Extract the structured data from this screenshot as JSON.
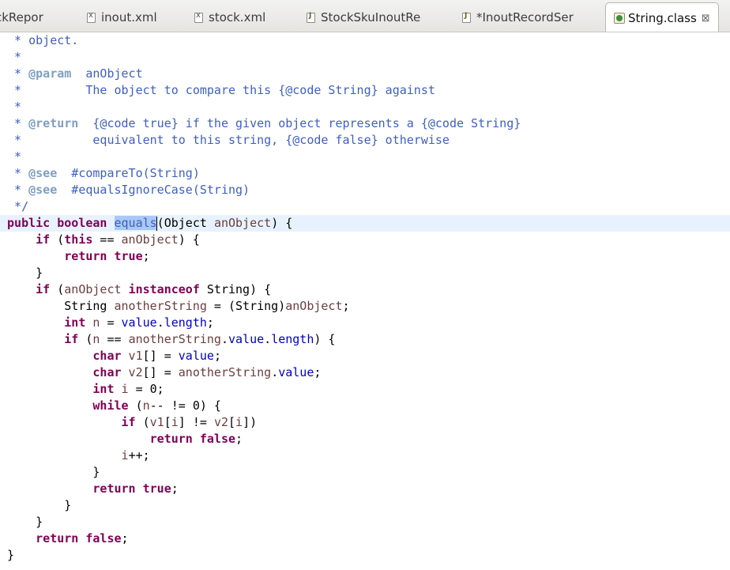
{
  "tabs": [
    {
      "label": "ckRepor",
      "icon": "none"
    },
    {
      "label": "inout.xml",
      "icon": "xml-file-icon"
    },
    {
      "label": "stock.xml",
      "icon": "xml-file-icon"
    },
    {
      "label": "StockSkuInoutRe",
      "icon": "java-file-icon"
    },
    {
      "label": "*InoutRecordSer",
      "icon": "java-file-icon"
    },
    {
      "label": "String.class",
      "icon": "class-file-icon",
      "active": true
    }
  ],
  "close_glyph": "⊠",
  "code": {
    "l1": "  * object.",
    "l2": "  *",
    "l3a": "  * ",
    "l3tag": "@param",
    "l3b": "  anObject",
    "l4": "  *         The object to compare this {@code String} against",
    "l5": "  *",
    "l6a": "  * ",
    "l6tag": "@return",
    "l6b": "  {@code true} if the given object represents a {@code String}",
    "l7": "  *          equivalent to this string, {@code false} otherwise",
    "l8": "  *",
    "l9a": "  * ",
    "l9tag": "@see",
    "l9b": "  #compareTo(String)",
    "l10a": "  * ",
    "l10tag": "@see",
    "l10b": "  #equalsIgnoreCase(String)",
    "l11": "  */",
    "m_kw1": "public",
    "m_kw2": "boolean",
    "m_name": "equals",
    "m_rest1": "(Object ",
    "m_param": "anObject",
    "m_rest2": ") {",
    "if1_kw": "if",
    "if1_a": " (",
    "if1_this": "this",
    "if1_b": " == ",
    "if1_var": "anObject",
    "if1_c": ") {",
    "ret_true_kw": "return",
    "ret_true_val": "true",
    "semi": ";",
    "close_brace": "}",
    "if2_kw": "if",
    "if2_a": " (",
    "if2_var": "anObject",
    "if2_inst": "instanceof",
    "if2_b": " String) {",
    "s_type": "String ",
    "s_var": "anotherString",
    "s_rest1": " = (String)",
    "s_var2": "anObject",
    "s_semi": ";",
    "n_kw": "int",
    "n_var": " n",
    "n_eq": " = ",
    "n_fld1": "value",
    "n_dot": ".",
    "n_fld2": "length",
    "n_semi": ";",
    "if3_kw": "if",
    "if3_a": " (",
    "if3_n": "n",
    "if3_b": " == ",
    "if3_as": "anotherString",
    "if3_dot1": ".",
    "if3_f1": "value",
    "if3_dot2": ".",
    "if3_f2": "length",
    "if3_c": ") {",
    "c1_kw": "char",
    "c1_var": " v1",
    "c1_rest": "[] = ",
    "c1_fld": "value",
    "c1_semi": ";",
    "c2_kw": "char",
    "c2_var": " v2",
    "c2_rest": "[] = ",
    "c2_as": "anotherString",
    "c2_dot": ".",
    "c2_fld": "value",
    "c2_semi": ";",
    "i_kw": "int",
    "i_var": " i",
    "i_rest": " = 0;",
    "w_kw": "while",
    "w_a": " (",
    "w_n": "n",
    "w_b": "-- != 0) {",
    "if4_kw": "if",
    "if4_a": " (",
    "if4_v1": "v1",
    "if4_b": "[",
    "if4_i": "i",
    "if4_c": "] != ",
    "if4_v2": "v2",
    "if4_d": "[",
    "if4_i2": "i",
    "if4_e": "])",
    "rf_kw": "return",
    "rf_val": "false",
    "inc_var": "i",
    "inc_rest": "++;",
    "ret_kw": "return"
  }
}
